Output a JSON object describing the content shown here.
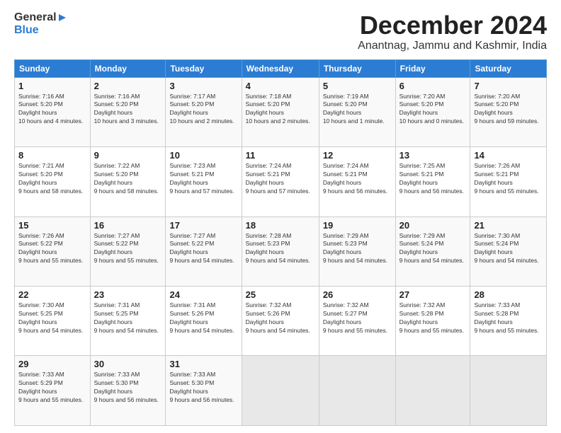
{
  "logo": {
    "general": "General",
    "blue": "Blue",
    "arrow": "▶"
  },
  "title": "December 2024",
  "location": "Anantnag, Jammu and Kashmir, India",
  "headers": [
    "Sunday",
    "Monday",
    "Tuesday",
    "Wednesday",
    "Thursday",
    "Friday",
    "Saturday"
  ],
  "weeks": [
    [
      {
        "day": "1",
        "sunrise": "7:16 AM",
        "sunset": "5:20 PM",
        "daylight": "10 hours and 4 minutes."
      },
      {
        "day": "2",
        "sunrise": "7:16 AM",
        "sunset": "5:20 PM",
        "daylight": "10 hours and 3 minutes."
      },
      {
        "day": "3",
        "sunrise": "7:17 AM",
        "sunset": "5:20 PM",
        "daylight": "10 hours and 2 minutes."
      },
      {
        "day": "4",
        "sunrise": "7:18 AM",
        "sunset": "5:20 PM",
        "daylight": "10 hours and 2 minutes."
      },
      {
        "day": "5",
        "sunrise": "7:19 AM",
        "sunset": "5:20 PM",
        "daylight": "10 hours and 1 minute."
      },
      {
        "day": "6",
        "sunrise": "7:20 AM",
        "sunset": "5:20 PM",
        "daylight": "10 hours and 0 minutes."
      },
      {
        "day": "7",
        "sunrise": "7:20 AM",
        "sunset": "5:20 PM",
        "daylight": "9 hours and 59 minutes."
      }
    ],
    [
      {
        "day": "8",
        "sunrise": "7:21 AM",
        "sunset": "5:20 PM",
        "daylight": "9 hours and 58 minutes."
      },
      {
        "day": "9",
        "sunrise": "7:22 AM",
        "sunset": "5:20 PM",
        "daylight": "9 hours and 58 minutes."
      },
      {
        "day": "10",
        "sunrise": "7:23 AM",
        "sunset": "5:21 PM",
        "daylight": "9 hours and 57 minutes."
      },
      {
        "day": "11",
        "sunrise": "7:24 AM",
        "sunset": "5:21 PM",
        "daylight": "9 hours and 57 minutes."
      },
      {
        "day": "12",
        "sunrise": "7:24 AM",
        "sunset": "5:21 PM",
        "daylight": "9 hours and 56 minutes."
      },
      {
        "day": "13",
        "sunrise": "7:25 AM",
        "sunset": "5:21 PM",
        "daylight": "9 hours and 56 minutes."
      },
      {
        "day": "14",
        "sunrise": "7:26 AM",
        "sunset": "5:21 PM",
        "daylight": "9 hours and 55 minutes."
      }
    ],
    [
      {
        "day": "15",
        "sunrise": "7:26 AM",
        "sunset": "5:22 PM",
        "daylight": "9 hours and 55 minutes."
      },
      {
        "day": "16",
        "sunrise": "7:27 AM",
        "sunset": "5:22 PM",
        "daylight": "9 hours and 55 minutes."
      },
      {
        "day": "17",
        "sunrise": "7:27 AM",
        "sunset": "5:22 PM",
        "daylight": "9 hours and 54 minutes."
      },
      {
        "day": "18",
        "sunrise": "7:28 AM",
        "sunset": "5:23 PM",
        "daylight": "9 hours and 54 minutes."
      },
      {
        "day": "19",
        "sunrise": "7:29 AM",
        "sunset": "5:23 PM",
        "daylight": "9 hours and 54 minutes."
      },
      {
        "day": "20",
        "sunrise": "7:29 AM",
        "sunset": "5:24 PM",
        "daylight": "9 hours and 54 minutes."
      },
      {
        "day": "21",
        "sunrise": "7:30 AM",
        "sunset": "5:24 PM",
        "daylight": "9 hours and 54 minutes."
      }
    ],
    [
      {
        "day": "22",
        "sunrise": "7:30 AM",
        "sunset": "5:25 PM",
        "daylight": "9 hours and 54 minutes."
      },
      {
        "day": "23",
        "sunrise": "7:31 AM",
        "sunset": "5:25 PM",
        "daylight": "9 hours and 54 minutes."
      },
      {
        "day": "24",
        "sunrise": "7:31 AM",
        "sunset": "5:26 PM",
        "daylight": "9 hours and 54 minutes."
      },
      {
        "day": "25",
        "sunrise": "7:32 AM",
        "sunset": "5:26 PM",
        "daylight": "9 hours and 54 minutes."
      },
      {
        "day": "26",
        "sunrise": "7:32 AM",
        "sunset": "5:27 PM",
        "daylight": "9 hours and 55 minutes."
      },
      {
        "day": "27",
        "sunrise": "7:32 AM",
        "sunset": "5:28 PM",
        "daylight": "9 hours and 55 minutes."
      },
      {
        "day": "28",
        "sunrise": "7:33 AM",
        "sunset": "5:28 PM",
        "daylight": "9 hours and 55 minutes."
      }
    ],
    [
      {
        "day": "29",
        "sunrise": "7:33 AM",
        "sunset": "5:29 PM",
        "daylight": "9 hours and 55 minutes."
      },
      {
        "day": "30",
        "sunrise": "7:33 AM",
        "sunset": "5:30 PM",
        "daylight": "9 hours and 56 minutes."
      },
      {
        "day": "31",
        "sunrise": "7:33 AM",
        "sunset": "5:30 PM",
        "daylight": "9 hours and 56 minutes."
      },
      null,
      null,
      null,
      null
    ]
  ]
}
